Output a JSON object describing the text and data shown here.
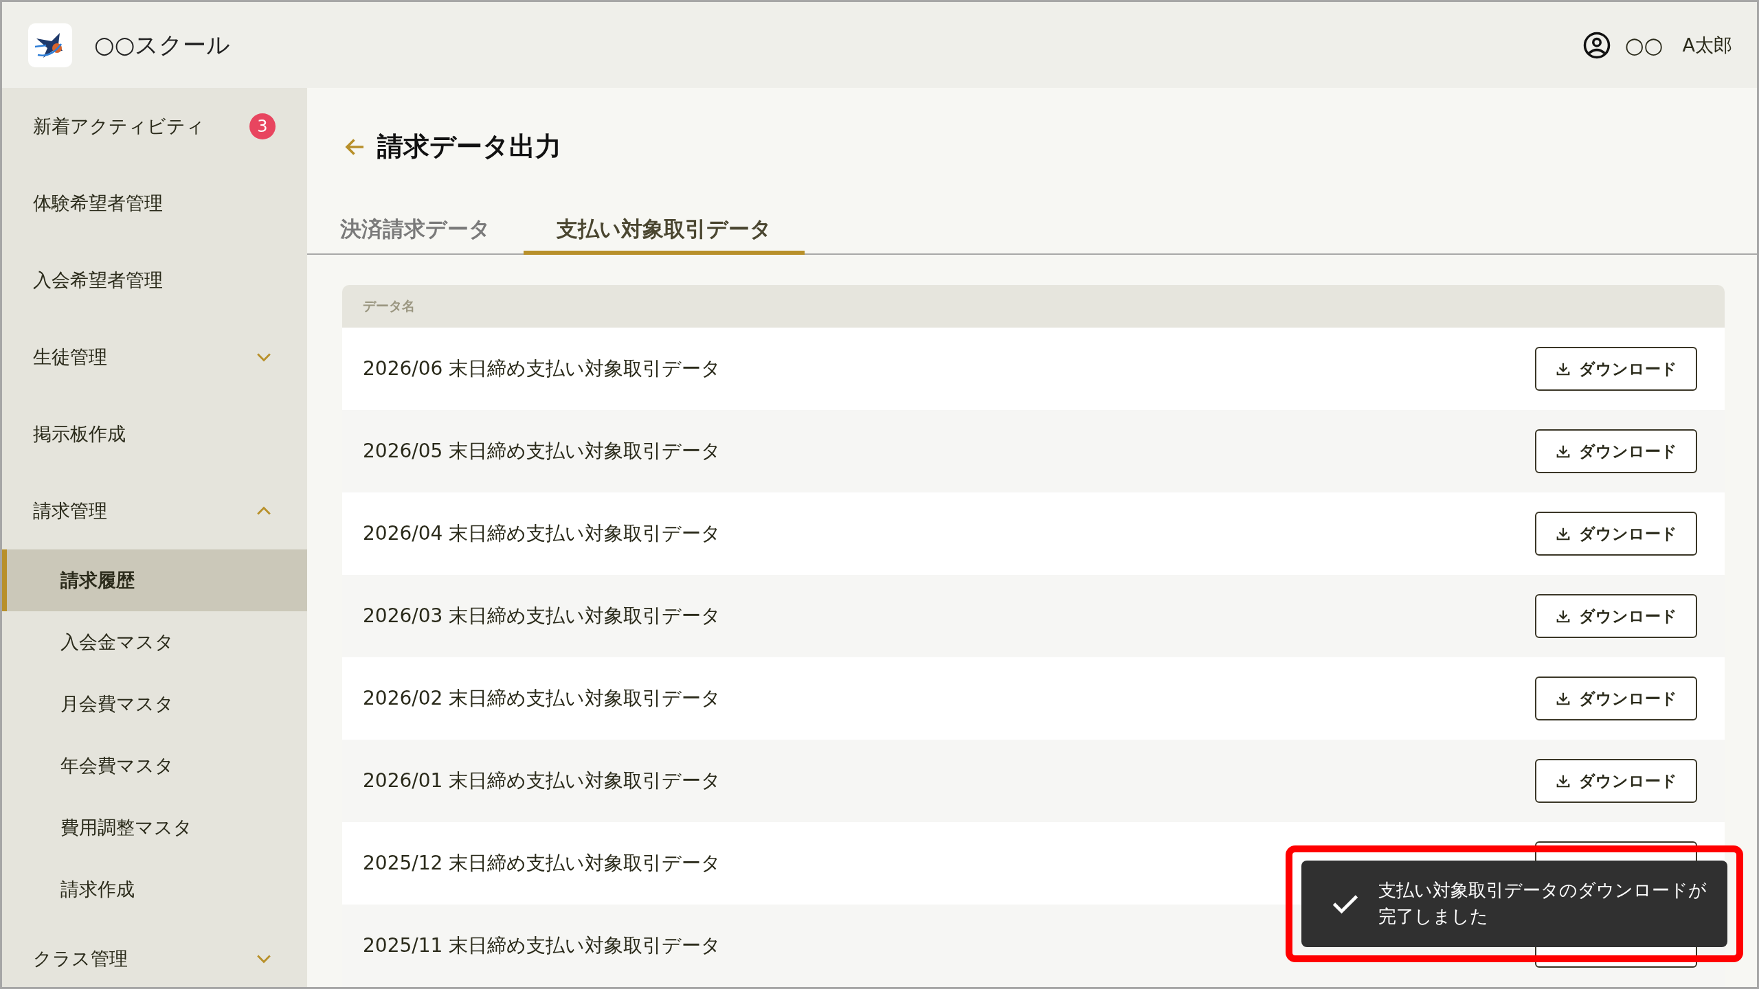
{
  "app": {
    "name": "○○スクール"
  },
  "user": {
    "org": "○○",
    "name": "A太郎"
  },
  "sidebar": {
    "items": [
      {
        "kind": "link",
        "label": "新着アクティビティ",
        "badge": "3",
        "selected": false
      },
      {
        "kind": "link",
        "label": "体験希望者管理",
        "selected": false
      },
      {
        "kind": "link",
        "label": "入会希望者管理",
        "selected": false
      },
      {
        "kind": "group",
        "label": "生徒管理",
        "expanded": false,
        "selected": false
      },
      {
        "kind": "link",
        "label": "掲示板作成",
        "selected": false
      },
      {
        "kind": "group",
        "label": "請求管理",
        "expanded": true,
        "selected": false,
        "children": [
          {
            "label": "請求履歴",
            "selected": true
          },
          {
            "label": "入会金マスタ",
            "selected": false
          },
          {
            "label": "月会費マスタ",
            "selected": false
          },
          {
            "label": "年会費マスタ",
            "selected": false
          },
          {
            "label": "費用調整マスタ",
            "selected": false
          },
          {
            "label": "請求作成",
            "selected": false
          }
        ]
      },
      {
        "kind": "group",
        "label": "クラス管理",
        "expanded": false,
        "selected": false
      }
    ]
  },
  "page": {
    "title": "請求データ出力"
  },
  "tabs": [
    {
      "label": "決済請求データ",
      "selected": false
    },
    {
      "label": "支払い対象取引データ",
      "selected": true
    }
  ],
  "table": {
    "columns": [
      "データ名"
    ],
    "rows": [
      {
        "name": "2026/06 末日締め支払い対象取引データ",
        "action": "ダウンロード"
      },
      {
        "name": "2026/05 末日締め支払い対象取引データ",
        "action": "ダウンロード"
      },
      {
        "name": "2026/04 末日締め支払い対象取引データ",
        "action": "ダウンロード"
      },
      {
        "name": "2026/03 末日締め支払い対象取引データ",
        "action": "ダウンロード"
      },
      {
        "name": "2026/02 末日締め支払い対象取引データ",
        "action": "ダウンロード"
      },
      {
        "name": "2026/01 末日締め支払い対象取引データ",
        "action": "ダウンロード"
      },
      {
        "name": "2025/12 末日締め支払い対象取引データ"
      },
      {
        "name": "2025/11 末日締め支払い対象取引データ"
      }
    ]
  },
  "toast": {
    "message": "支払い対象取引データのダウンロードが完了しました"
  }
}
